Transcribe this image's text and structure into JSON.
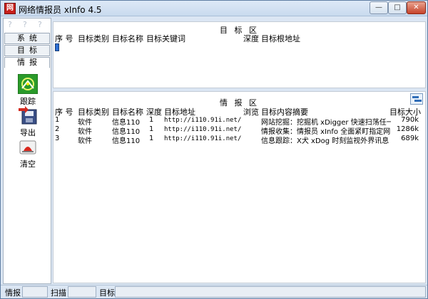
{
  "window": {
    "title": "网络情报员 xInfo 4.5",
    "app_icon_glyph": "网",
    "minimize_glyph": "—",
    "maximize_glyph": "□",
    "close_glyph": "✕"
  },
  "sidebar": {
    "help_marks": [
      "?",
      "?",
      "?"
    ],
    "tabs": [
      "系统",
      "目标",
      "情报"
    ],
    "active_tab": "情报",
    "tools": [
      {
        "label": "跟踪",
        "icon": "track-icon"
      },
      {
        "label": "导出",
        "icon": "export-icon"
      },
      {
        "label": "清空",
        "icon": "clear-icon"
      }
    ]
  },
  "target_pane": {
    "title": "目 标 区",
    "columns": [
      "序 号",
      "目标类别",
      "目标名称",
      "目标关键词",
      "深度",
      "目标根地址"
    ]
  },
  "intel_pane": {
    "title": "情 报 区",
    "columns": [
      "序 号",
      "目标类别",
      "目标名称",
      "深度",
      "目标地址",
      "浏览",
      "目标内容摘要",
      "目标大小"
    ],
    "rows": [
      {
        "no": "1",
        "category": "软件",
        "name": "信息110",
        "depth": "1",
        "url": "http://i110.91i.net/",
        "summary": "网站挖掘：挖掘机 xDigger 快速扫荡任一",
        "size": "790k"
      },
      {
        "no": "2",
        "category": "软件",
        "name": "信息110",
        "depth": "1",
        "url": "http://i110.91i.net/",
        "summary": "情报收集：情报员 xInfo 全面紧盯指定网",
        "size": "1286k"
      },
      {
        "no": "3",
        "category": "软件",
        "name": "信息110",
        "depth": "1",
        "url": "http://i110.91i.net/",
        "summary": "信息跟踪：X犬 xDog 时刻监视外界讯息",
        "size": "689k"
      }
    ]
  },
  "statusbar": {
    "labels": [
      "情报",
      "扫描",
      "目标"
    ]
  },
  "colors": {
    "window_bg": "#dbe6f3",
    "title_bar": "#c9daee",
    "close_button": "#c6432a",
    "caret_blue": "#2e6fd3"
  }
}
